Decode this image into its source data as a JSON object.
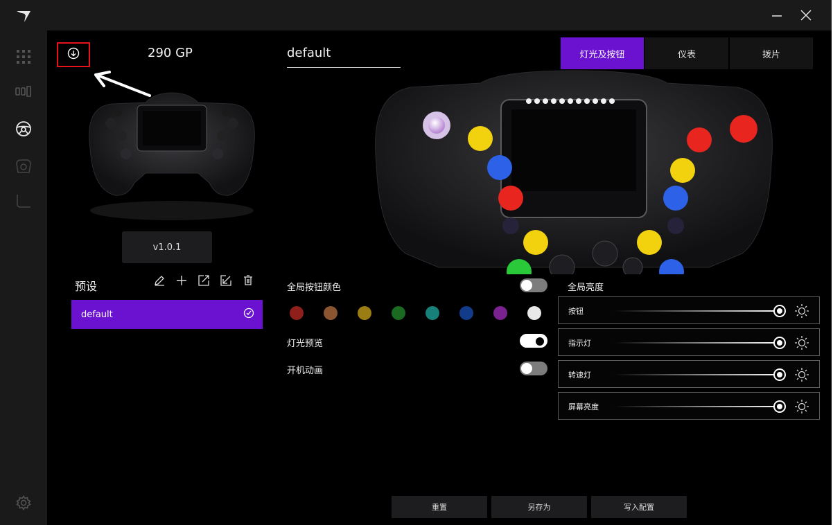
{
  "app": {
    "accent": "#6a12d0"
  },
  "nav_icons": [
    "logo-icon",
    "grid-icon",
    "pedals-icon",
    "steering-wheel-icon",
    "wheel-base-icon",
    "shifter-icon",
    "gear-icon"
  ],
  "left": {
    "model_name": "290 GP",
    "version": "v1.0.1",
    "presets_title": "预设",
    "presets": [
      {
        "label": "default",
        "selected": true
      }
    ]
  },
  "profile": {
    "name": "default"
  },
  "tabs": [
    {
      "label": "灯光及按钮",
      "active": true
    },
    {
      "label": "仪表",
      "active": false
    },
    {
      "label": "拨片",
      "active": false
    }
  ],
  "lighting": {
    "global_color_label": "全局按钮颜色",
    "global_color_enabled": false,
    "swatches": [
      "#8e1f1b",
      "#8a5530",
      "#9a7d13",
      "#1a6a22",
      "#17807a",
      "#123b8a",
      "#7a2290",
      "#e8e8e8"
    ],
    "preview_label": "灯光预览",
    "preview_enabled": true,
    "boot_anim_label": "开机动画",
    "boot_anim_enabled": false
  },
  "brightness": {
    "title": "全局亮度",
    "sliders": [
      {
        "label": "按钮",
        "level": 1.0
      },
      {
        "label": "指示灯",
        "level": 1.0
      },
      {
        "label": "转速灯",
        "level": 1.0
      },
      {
        "label": "屏幕亮度",
        "level": 1.0
      }
    ]
  },
  "actions": {
    "reset": "重置",
    "save_as": "另存为",
    "write": "写入配置"
  }
}
